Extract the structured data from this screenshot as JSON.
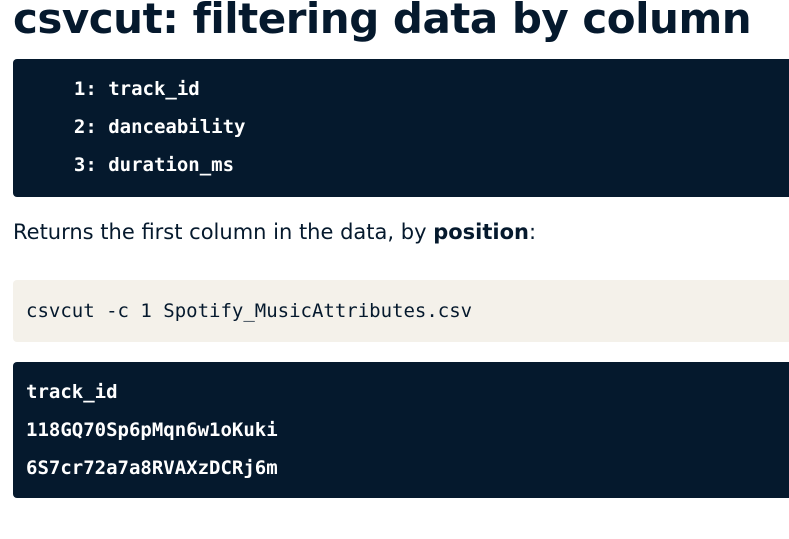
{
  "title": "csvcut: filtering data by column",
  "columns_output": [
    "  1: track_id",
    "  2: danceability",
    "  3: duration_ms"
  ],
  "description": {
    "text": "Returns the first column in the data, by ",
    "emphasis": "position",
    "suffix": ":"
  },
  "command": "csvcut -c 1 Spotify_MusicAttributes.csv",
  "result_output": [
    "track_id",
    "118GQ70Sp6pMqn6w1oKuki",
    "6S7cr72a7a8RVAXzDCRj6m"
  ]
}
